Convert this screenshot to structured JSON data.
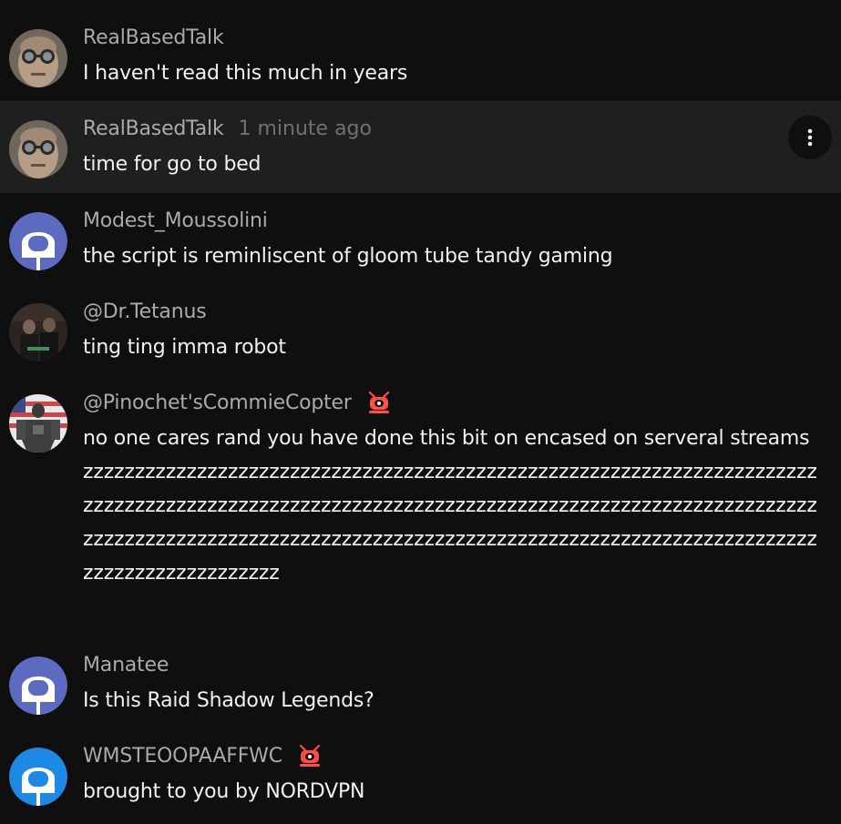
{
  "messages": [
    {
      "author": "RealBasedTalk",
      "text": "I haven't read this much in years",
      "avatar": "glasses-man-avatar"
    },
    {
      "author": "RealBasedTalk",
      "timestamp": "1 minute ago",
      "text": "time for go to bed",
      "avatar": "glasses-man-avatar",
      "hovered": true
    },
    {
      "author": "Modest_Moussolini",
      "text": "the script is reminliscent of gloom tube tandy gaming",
      "avatar": "default-blue-avatar"
    },
    {
      "author": "@Dr.Tetanus",
      "text": "ting ting imma robot",
      "avatar": "photo-avatar"
    },
    {
      "author": "@Pinochet'sCommieCopter",
      "badge": "moderator-robot-badge",
      "text": "no one cares rand you have done this bit on encased on serveral streams zzzzzzzzzzzzzzzzzzzzzzzzzzzzzzzzzzzzzzzzzzzzzzzzzzzzzzzzzzzzzzzzzzzzzzzzzzzzzzzzzzzzzzzzzzzzzzzzzzzzzzzzzzzzzzzzzzzzzzzzzzzzzzzzzzzzzzzzzzzzzzzzzzzzzzzzzzzzzzzzzzzzzzzzzzzzzzzzzzzzzzzzzzzzzzzzzzzzzzzzzzzzzzzzzzzzzzzzzzzzzzzzzzzzzzzz",
      "avatar": "armored-figure-avatar"
    },
    {
      "author": "Manatee",
      "text": "Is this Raid Shadow Legends?",
      "avatar": "default-blue-avatar"
    },
    {
      "author": "WMSTEOOPAAFFWC",
      "badge": "moderator-robot-badge",
      "text": "brought to you by NORDVPN",
      "avatar": "default-lightblue-avatar"
    }
  ],
  "colors": {
    "background": "#0f0f0f",
    "hover_background": "#1f1f1f",
    "author": "#aaaaaa",
    "timestamp": "#717171",
    "text": "#f1f1f1",
    "badge": "#ff4e45",
    "default_avatar": "#5c6bc0"
  },
  "icons": {
    "menu": "more-vert-icon"
  }
}
